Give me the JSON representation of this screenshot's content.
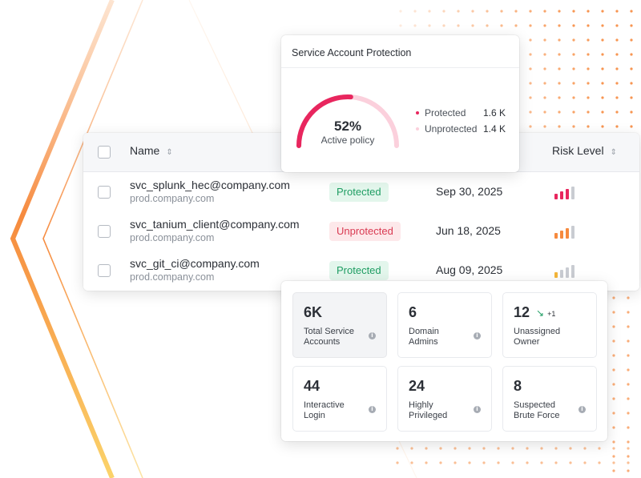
{
  "colors": {
    "accent_pink": "#e8265e",
    "light_pink": "#fbd0dc",
    "protected_green": "#1f9d63",
    "unprotected_red": "#d93a52",
    "decor_orange": "#f68a3e",
    "decor_yellow": "#fbd36a"
  },
  "table": {
    "columns": {
      "name": "Name",
      "risk": "Risk Level"
    },
    "rows": [
      {
        "account": "svc_splunk_hec@company.com",
        "domain": "prod.company.com",
        "status": "Protected",
        "date": "Sep 30, 2025",
        "risk_level": "high",
        "risk_bars_filled": 3
      },
      {
        "account": "svc_tanium_client@company.com",
        "domain": "prod.company.com",
        "status": "Unprotected",
        "date": "Jun 18, 2025",
        "risk_level": "medium",
        "risk_bars_filled": 3
      },
      {
        "account": "svc_git_ci@company.com",
        "domain": "prod.company.com",
        "status": "Protected",
        "date": "Aug 09, 2025",
        "risk_level": "low",
        "risk_bars_filled": 1
      }
    ]
  },
  "protection": {
    "title": "Service Account Protection",
    "percent": "52%",
    "percent_value": 52,
    "label": "Active policy",
    "legend": [
      {
        "name": "Protected",
        "value": "1.6 K",
        "color": "#e8265e"
      },
      {
        "name": "Unprotected",
        "value": "1.4 K",
        "color": "#fbd0dc"
      }
    ]
  },
  "stats": [
    {
      "value": "6K",
      "label": "Total Service Accounts",
      "info": true
    },
    {
      "value": "6",
      "label": "Domain Admins",
      "info": true
    },
    {
      "value": "12",
      "label": "Unassigned Owner",
      "info": false,
      "trend": "+1"
    },
    {
      "value": "44",
      "label": "Interactive Login",
      "info": true
    },
    {
      "value": "24",
      "label": "Highly Privileged",
      "info": true
    },
    {
      "value": "8",
      "label": "Suspected Brute Force",
      "info": true
    }
  ]
}
